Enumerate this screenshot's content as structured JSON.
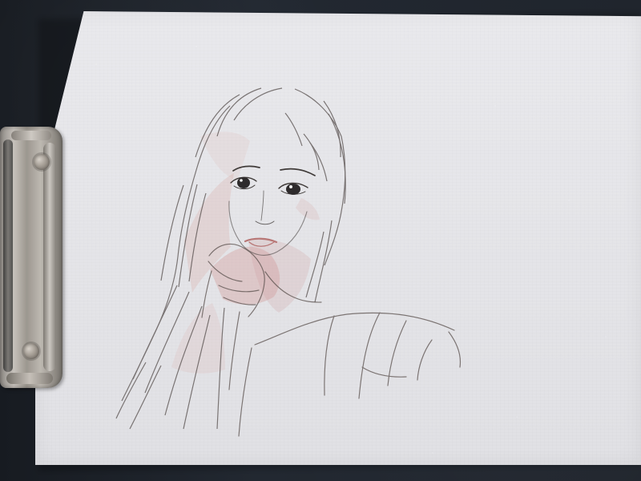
{
  "scene": {
    "background_color": "#1f242b",
    "paper_color": "#e6e6ea",
    "pencil_color": "#3f3a38",
    "wash_color": "#c98f8b",
    "lip_color": "#b87776"
  }
}
